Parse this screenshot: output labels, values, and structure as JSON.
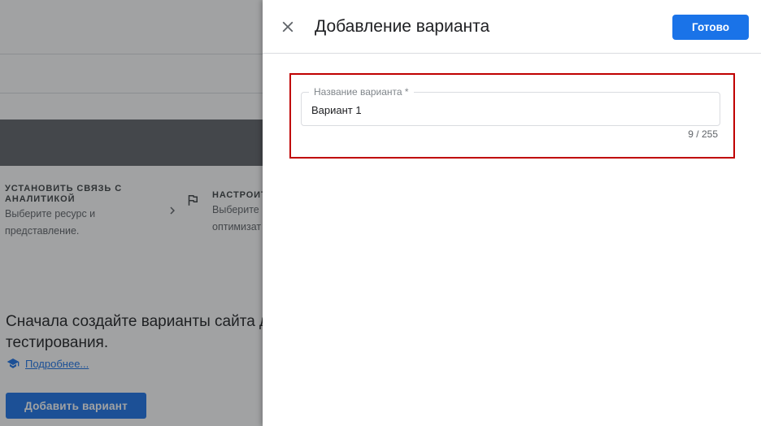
{
  "background": {
    "steps": [
      {
        "title_line1": "УСТАНОВИТЬ СВЯЗЬ С",
        "title_line2": "АНАЛИТИКОЙ",
        "sub_line1": "Выберите ресурс и",
        "sub_line2": "представление."
      },
      {
        "title": "НАСТРОИТ",
        "sub_line1": "Выберите",
        "sub_line2": "оптимизат"
      }
    ],
    "empty_message": "Сначала создайте варианты сайта для тестирования.",
    "learn_more": "Подробнее...",
    "add_variant_button": "Добавить вариант",
    "icons": {
      "step_chevron": "chevron-right-icon",
      "step_flag": "flag-icon",
      "learn": "graduation-cap-icon"
    }
  },
  "panel": {
    "title": "Добавление варианта",
    "done_button": "Готово",
    "close_icon": "close-icon",
    "field": {
      "label": "Название варианта *",
      "value": "Вариант 1",
      "counter": "9 / 255"
    },
    "highlight_color": "#c00000"
  },
  "colors": {
    "accent": "#1a73e8",
    "scrim": "rgba(32,33,36,0.42)"
  }
}
